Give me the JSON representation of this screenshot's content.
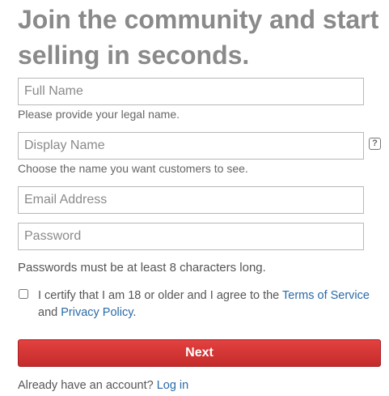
{
  "heading": "Join the community and start selling in seconds.",
  "fields": {
    "full_name": {
      "placeholder": "Full Name",
      "hint": "Please provide your legal name."
    },
    "display_name": {
      "placeholder": "Display Name",
      "hint": "Choose the name you want customers to see.",
      "help_icon": "?"
    },
    "email": {
      "placeholder": "Email Address"
    },
    "password": {
      "placeholder": "Password",
      "rule": "Passwords must be at least 8 characters long."
    }
  },
  "certify": {
    "text_before": "I certify that I am 18 or older and I agree to the ",
    "terms_link": "Terms of Service",
    "text_middle": " and ",
    "privacy_link": "Privacy Policy",
    "text_after": "."
  },
  "next_button": "Next",
  "login": {
    "prompt": "Already have an account? ",
    "link": "Log in"
  },
  "colors": {
    "accent": "#d13636",
    "link": "#2a6aa8",
    "heading": "#8a8a8a"
  }
}
